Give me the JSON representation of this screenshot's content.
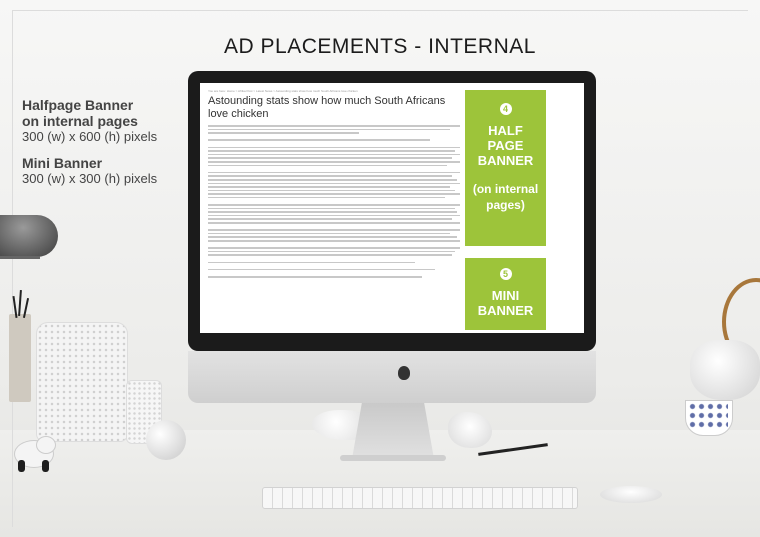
{
  "title": "AD PLACEMENTS - INTERNAL",
  "info": {
    "halfpage_heading_1": "Halfpage Banner",
    "halfpage_heading_2": "on internal pages",
    "halfpage_size": "300 (w) x 600 (h) pixels",
    "mini_heading": "Mini Banner",
    "mini_size": "300 (w) x 300 (h) pixels"
  },
  "article": {
    "breadcrumb": "You are here: Home > Afrika Post > Latest News > Astounding stats show how much South Africans love chicken",
    "headline": "Astounding stats show how much South Africans love chicken",
    "text_line_widths": [
      100,
      96,
      60,
      0,
      88,
      0,
      100,
      98,
      100,
      97,
      100,
      95,
      0,
      100,
      97,
      99,
      100,
      96,
      98,
      100,
      94,
      0,
      100,
      98,
      99,
      100,
      97,
      100,
      0,
      100,
      96,
      99,
      100,
      0,
      100,
      98,
      97,
      0,
      82,
      0,
      90,
      0,
      85
    ]
  },
  "ads": {
    "half": {
      "number": "4",
      "line1": "HALF",
      "line2": "PAGE",
      "line3": "BANNER",
      "sub1": "(on internal",
      "sub2": "pages)"
    },
    "mini": {
      "number": "5",
      "line1": "MINI",
      "line2": "BANNER"
    }
  },
  "colors": {
    "ad_green": "#9dc43a",
    "monitor_bezel": "#1b1b1b",
    "text_dark": "#444444"
  },
  "icons": [
    "apple-logo-icon"
  ]
}
